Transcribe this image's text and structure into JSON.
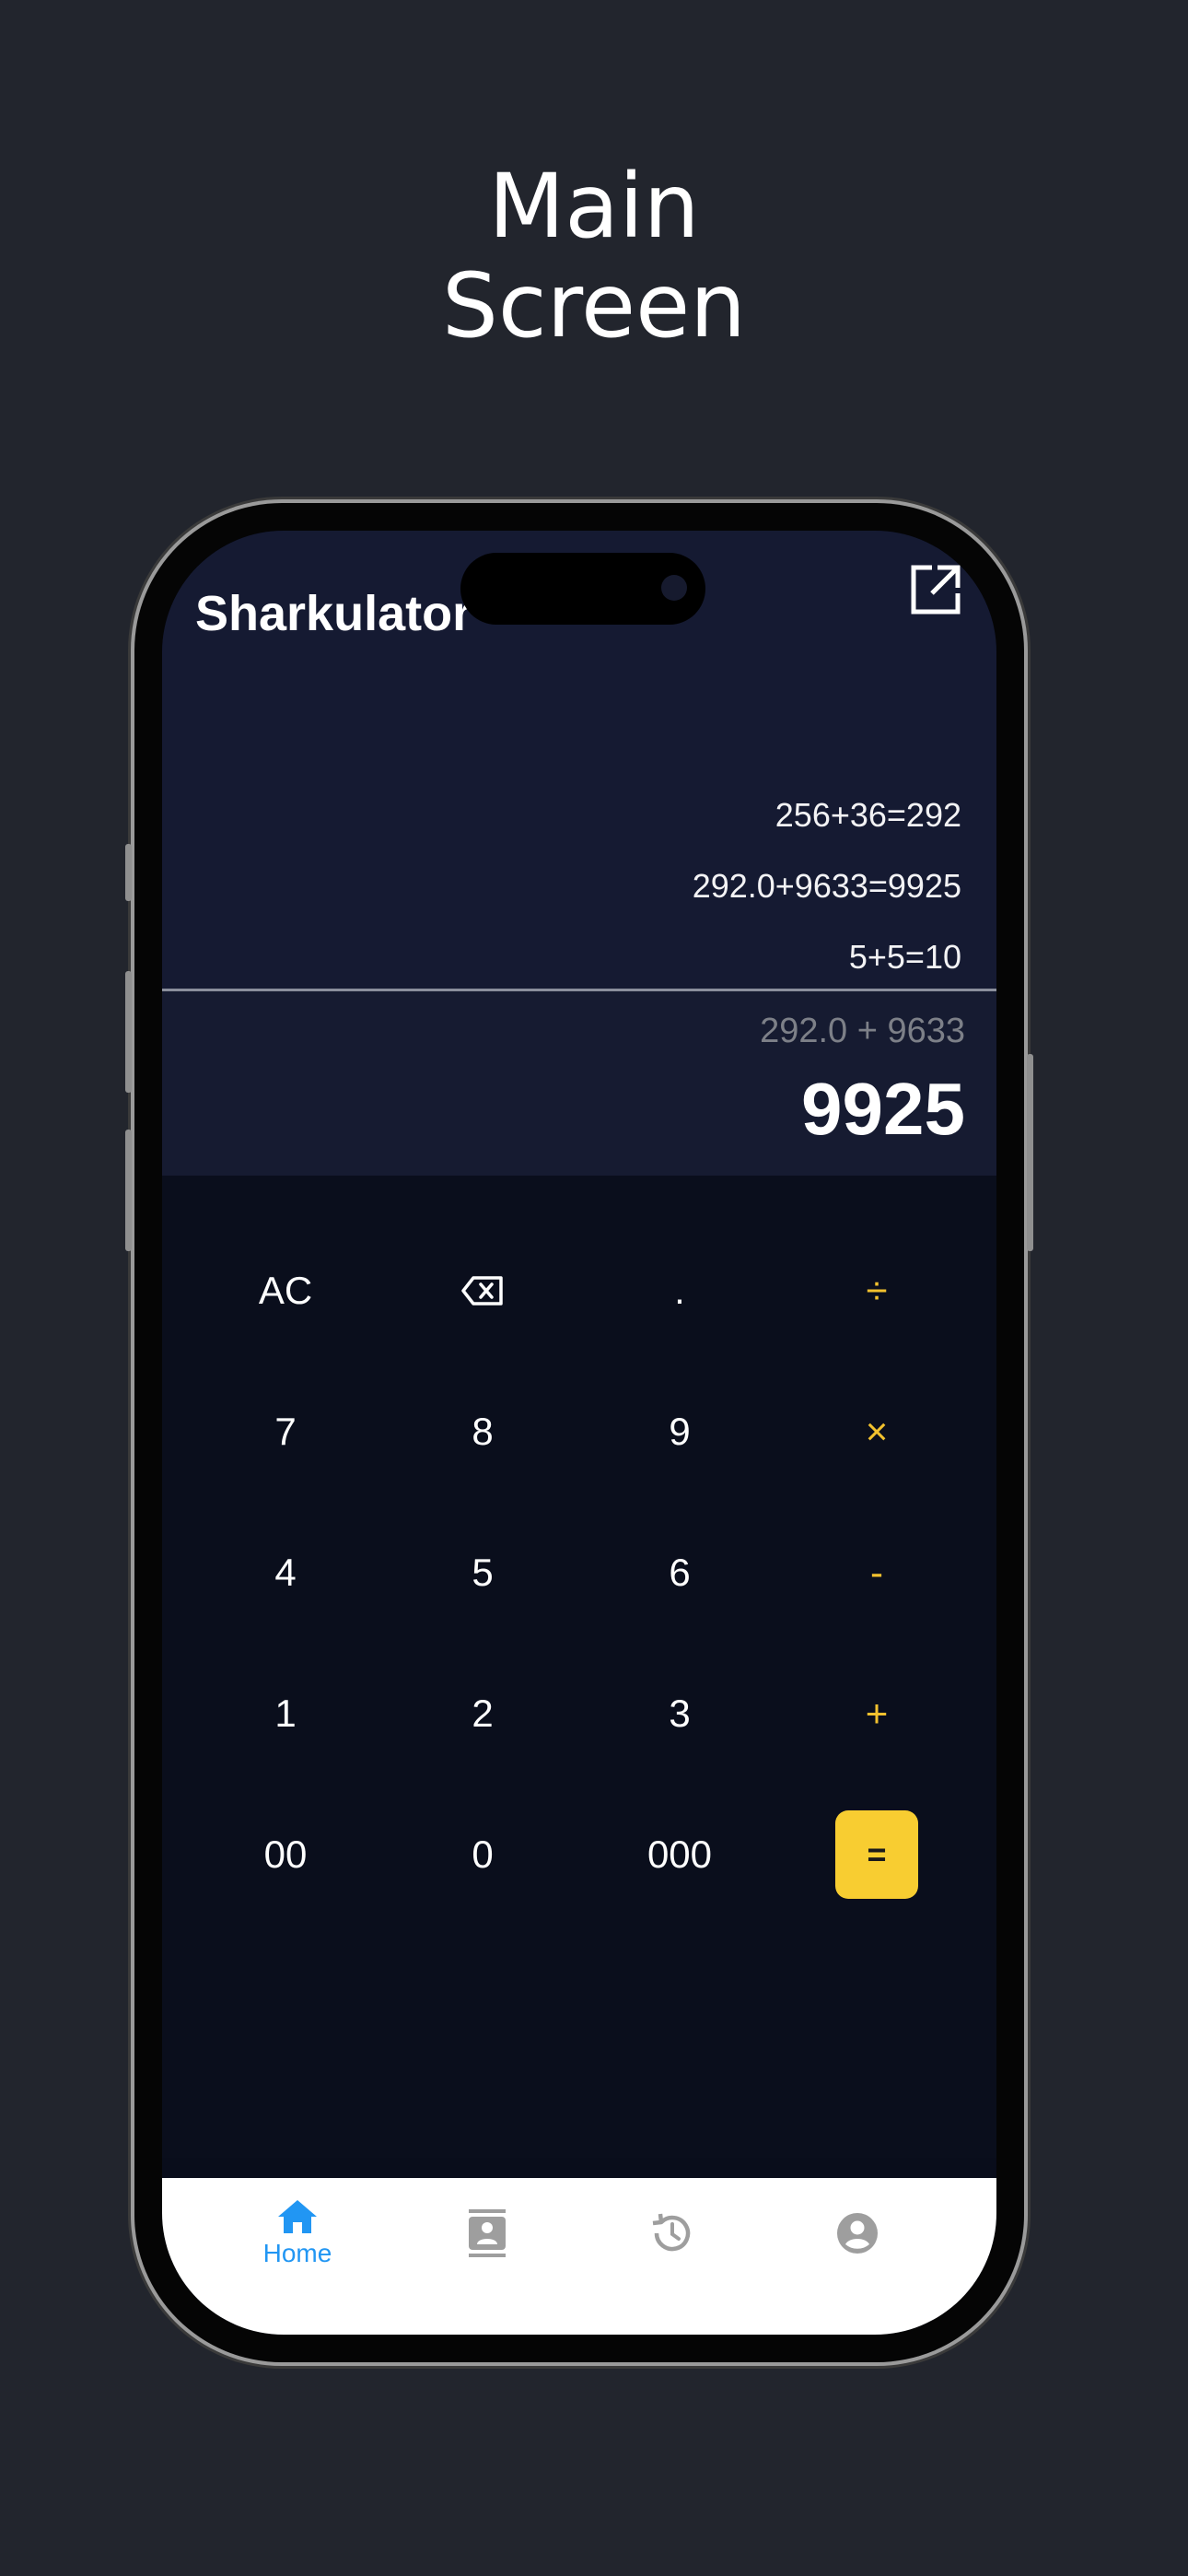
{
  "headline": {
    "line1": "Main",
    "line2": "Screen"
  },
  "app": {
    "title": "Sharkulator",
    "share_icon": "share-external-icon"
  },
  "history": [
    "256+36=292",
    "292.0+9633=9925",
    "5+5=10"
  ],
  "display": {
    "expression": "292.0 + 9633",
    "result": "9925"
  },
  "keys": {
    "row1": [
      "AC",
      "⌫",
      ".",
      "÷"
    ],
    "row2": [
      "7",
      "8",
      "9",
      "×"
    ],
    "row3": [
      "4",
      "5",
      "6",
      "-"
    ],
    "row4": [
      "1",
      "2",
      "3",
      "+"
    ],
    "row5": [
      "00",
      "0",
      "000",
      "="
    ]
  },
  "nav": {
    "home_label": "Home",
    "items": [
      "home-icon",
      "contacts-icon",
      "history-icon",
      "account-icon"
    ]
  },
  "colors": {
    "background": "#22252d",
    "accent": "#f8cd31",
    "nav_active": "#2196f3",
    "nav_inactive": "#9e9e9e"
  }
}
